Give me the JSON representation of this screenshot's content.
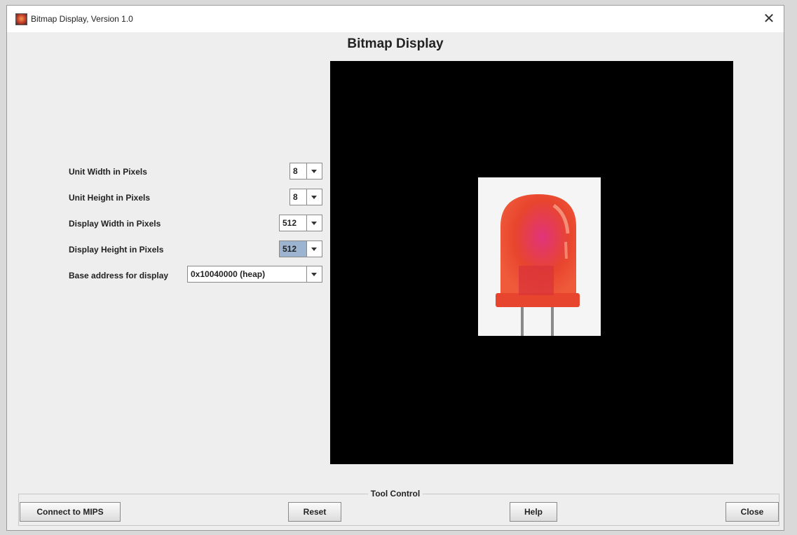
{
  "window": {
    "title": "Bitmap Display, Version 1.0",
    "close_glyph": "✕"
  },
  "heading": "Bitmap Display",
  "settings": [
    {
      "label": "Unit Width in Pixels",
      "value": "8"
    },
    {
      "label": "Unit Height in Pixels",
      "value": "8"
    },
    {
      "label": "Display Width in Pixels",
      "value": "512"
    },
    {
      "label": "Display Height in Pixels",
      "value": "512"
    },
    {
      "label": "Base address for display",
      "value": "0x10040000 (heap)"
    }
  ],
  "tool_control": {
    "label": "Tool Control",
    "buttons": {
      "connect": "Connect to MIPS",
      "reset": "Reset",
      "help": "Help",
      "close": "Close"
    }
  },
  "colors": {
    "display_background": "#000000",
    "led_red": "#e8452e",
    "selection": "#9db4d0"
  },
  "icons": {
    "app": "mars-app-icon",
    "close": "close-icon",
    "dropdown": "chevron-down-icon"
  }
}
